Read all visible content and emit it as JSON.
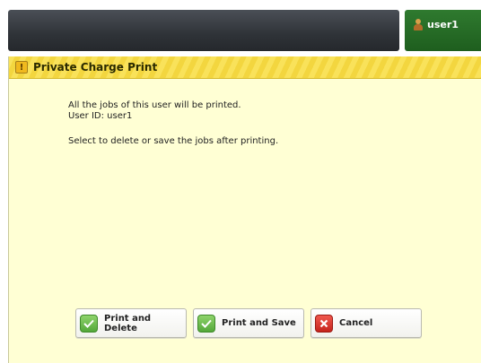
{
  "header": {
    "user_name": "user1"
  },
  "dialog": {
    "title": "Private Charge Print",
    "message_line1": "All the jobs of this user will be printed.",
    "message_line2": "User ID: user1",
    "message_line3": "Select to delete or save the jobs after printing."
  },
  "buttons": {
    "print_delete_line1": "Print and",
    "print_delete_line2": "Delete",
    "print_save": "Print and Save",
    "cancel": "Cancel"
  },
  "colors": {
    "title_bar": "#f9e25a",
    "panel_bg": "#ffffd4",
    "user_tab": "#2f7a2f",
    "top_bar": "#2f3338"
  }
}
